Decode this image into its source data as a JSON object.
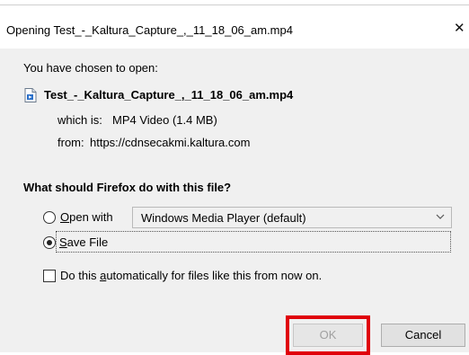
{
  "dialog": {
    "title": "Opening Test_-_Kaltura_Capture_,_11_18_06_am.mp4",
    "close_glyph": "✕",
    "intro": "You have chosen to open:",
    "file": {
      "icon": "media-file-icon",
      "name": "Test_-_Kaltura_Capture_,_11_18_06_am.mp4",
      "which_is_label": "which is:",
      "which_is_value": "MP4 Video (1.4 MB)",
      "from_label": "from:",
      "from_value": "https://cdnsecakmi.kaltura.com"
    },
    "question": "What should Firefox do with this file?",
    "options": {
      "open_with": {
        "mnemonic": "O",
        "label_rest": "pen with",
        "selected": false,
        "app_select_value": "Windows Media Player (default)"
      },
      "save_file": {
        "mnemonic": "S",
        "label_rest": "ave File",
        "selected": true
      }
    },
    "auto_checkbox": {
      "label_before": "Do this ",
      "mnemonic": "a",
      "label_after": "utomatically for files like this from now on.",
      "checked": false
    },
    "buttons": {
      "ok": "OK",
      "cancel": "Cancel"
    }
  },
  "colors": {
    "highlight": "#e0000a",
    "dialog_bg": "#f0f0f0"
  }
}
